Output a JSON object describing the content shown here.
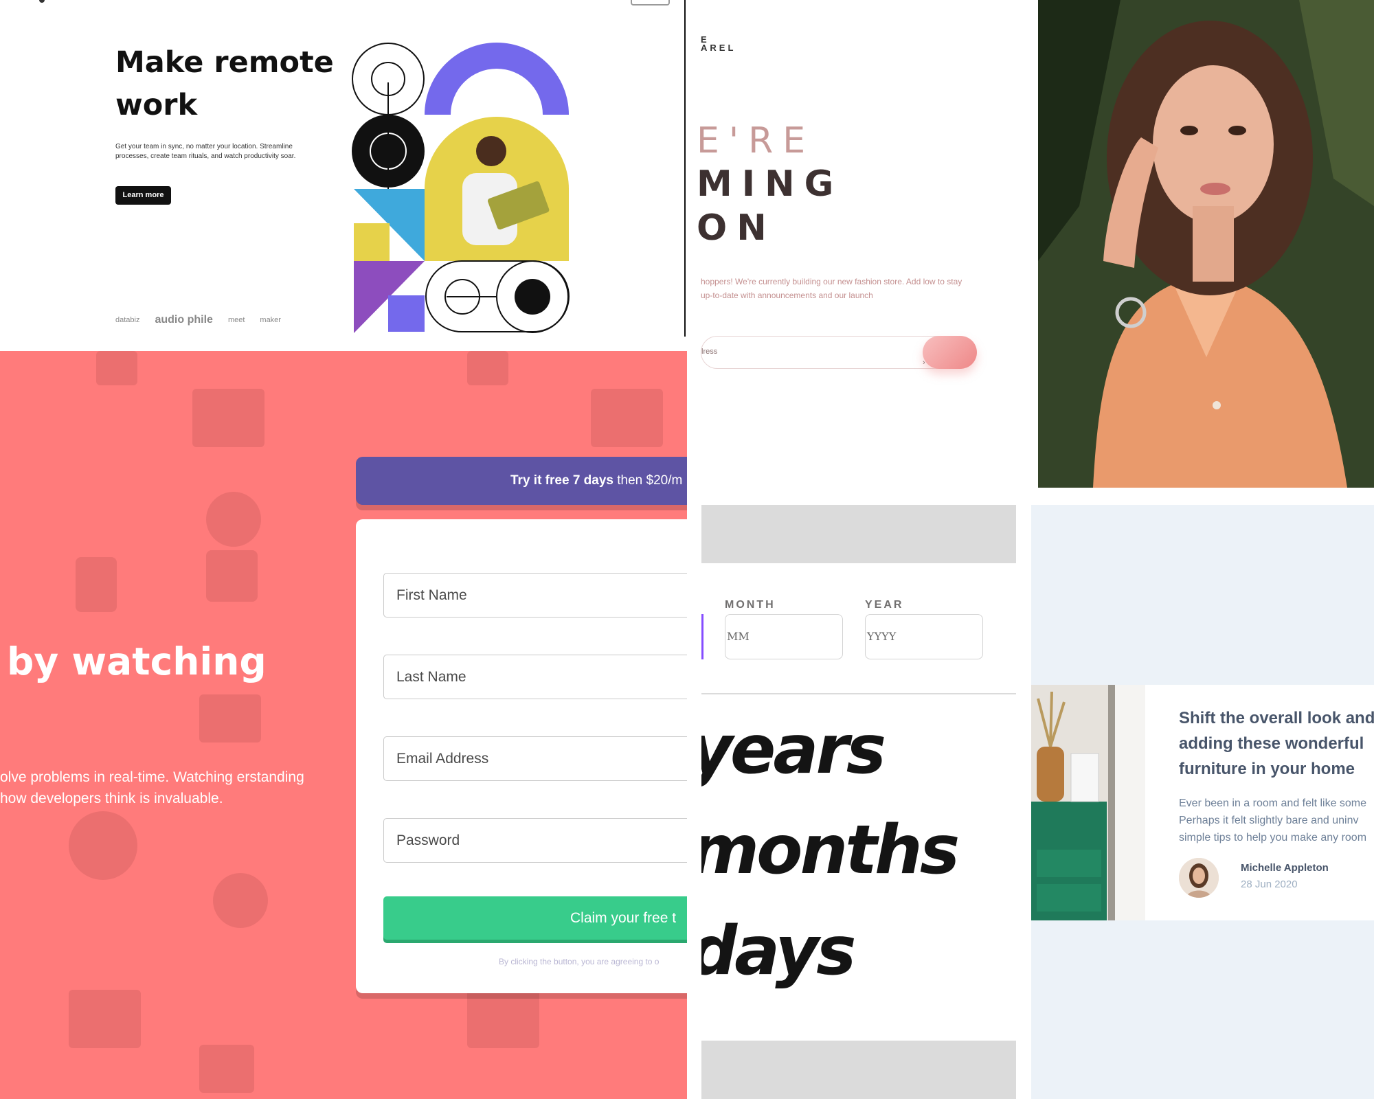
{
  "remote_work": {
    "title": "Make remote work",
    "description": "Get your team in sync, no matter your location. Streamline processes, create team rituals, and watch productivity soar.",
    "cta": "Learn more",
    "clients": [
      "databiz",
      "audio phile",
      "meet",
      "maker"
    ]
  },
  "coming_soon": {
    "brand": "E\nAREL",
    "heading_line1": "E'RE",
    "heading_line2": "MING",
    "heading_line3": "ON",
    "paragraph": "hoppers! We're currently building our new fashion store. Add low to stay up-to-date with announcements and our launch",
    "email_placeholder": "lress",
    "submit_icon": "chevron-right-icon"
  },
  "signup": {
    "headline": "by watching",
    "subtext": "olve problems in real-time. Watching erstanding how developers think is invaluable.",
    "promo_bold": "Try it free 7 days",
    "promo_rest": " then $20/m",
    "fields": {
      "first_name": "First Name",
      "last_name": "Last Name",
      "email": "Email Address",
      "password": "Password"
    },
    "claim_button": "Claim your free t",
    "terms": "By clicking the button, you are agreeing to o",
    "colors": {
      "background": "#ff7b7b",
      "promo": "#5e54a4",
      "claim": "#38cc8b"
    }
  },
  "age_calc": {
    "month_label": "MONTH",
    "year_label": "YEAR",
    "month_placeholder": "MM",
    "year_placeholder": "YYYY",
    "years": "years",
    "months": "months",
    "days": "days",
    "accent": "#854dff"
  },
  "article": {
    "title": "Shift the overall look and adding these wonderful furniture in your home",
    "excerpt": "Ever been in a room and felt like some Perhaps it felt slightly bare and uninv simple tips to help you make any room",
    "author": "Michelle Appleton",
    "date": "28 Jun 2020"
  }
}
